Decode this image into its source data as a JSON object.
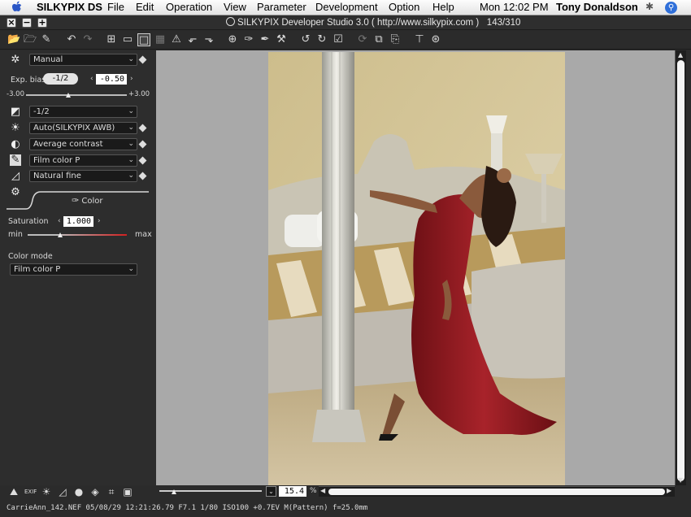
{
  "menubar": {
    "app": "SILKYPIX DS",
    "items": [
      "File",
      "Edit",
      "Operation",
      "View",
      "Parameter",
      "Development",
      "Option",
      "Help"
    ],
    "clock": "Mon 12:02 PM",
    "user": "Tony Donaldson"
  },
  "window": {
    "title": "SILKYPIX Developer Studio 3.0 ( http://www.silkypix.com )",
    "counter": "143/310"
  },
  "panel": {
    "preset": "Manual",
    "exp_bias_label": "Exp. bias",
    "exp_bias_step": "-1/2",
    "exp_bias_value": "-0.50",
    "exp_min": "-3.00",
    "exp_max": "+3.00",
    "exp_level": 0.42,
    "tone_value": "-1/2",
    "white_balance": "Auto(SILKYPIX AWB)",
    "contrast": "Average contrast",
    "color": "Film color P",
    "sharpness": "Natural fine",
    "tab_label": "Color",
    "saturation_label": "Saturation",
    "saturation_value": "1.000",
    "sat_min": "min",
    "sat_max": "max",
    "sat_level": 0.33,
    "color_mode_label": "Color mode",
    "color_mode": "Film color P"
  },
  "bottom": {
    "zoom_value": "15.4",
    "zoom_unit": "%"
  },
  "status": {
    "info": "CarrieAnn_142.NEF 05/08/29 12:21:26.79 F7.1 1/80 ISO100 +0.7EV M(Pattern) f=25.0mm"
  },
  "colors": {
    "dress": "#8e1a20",
    "wall": "#d7c99a",
    "viewer_bg": "#a9a9a9",
    "slider_red": "#d02020"
  }
}
